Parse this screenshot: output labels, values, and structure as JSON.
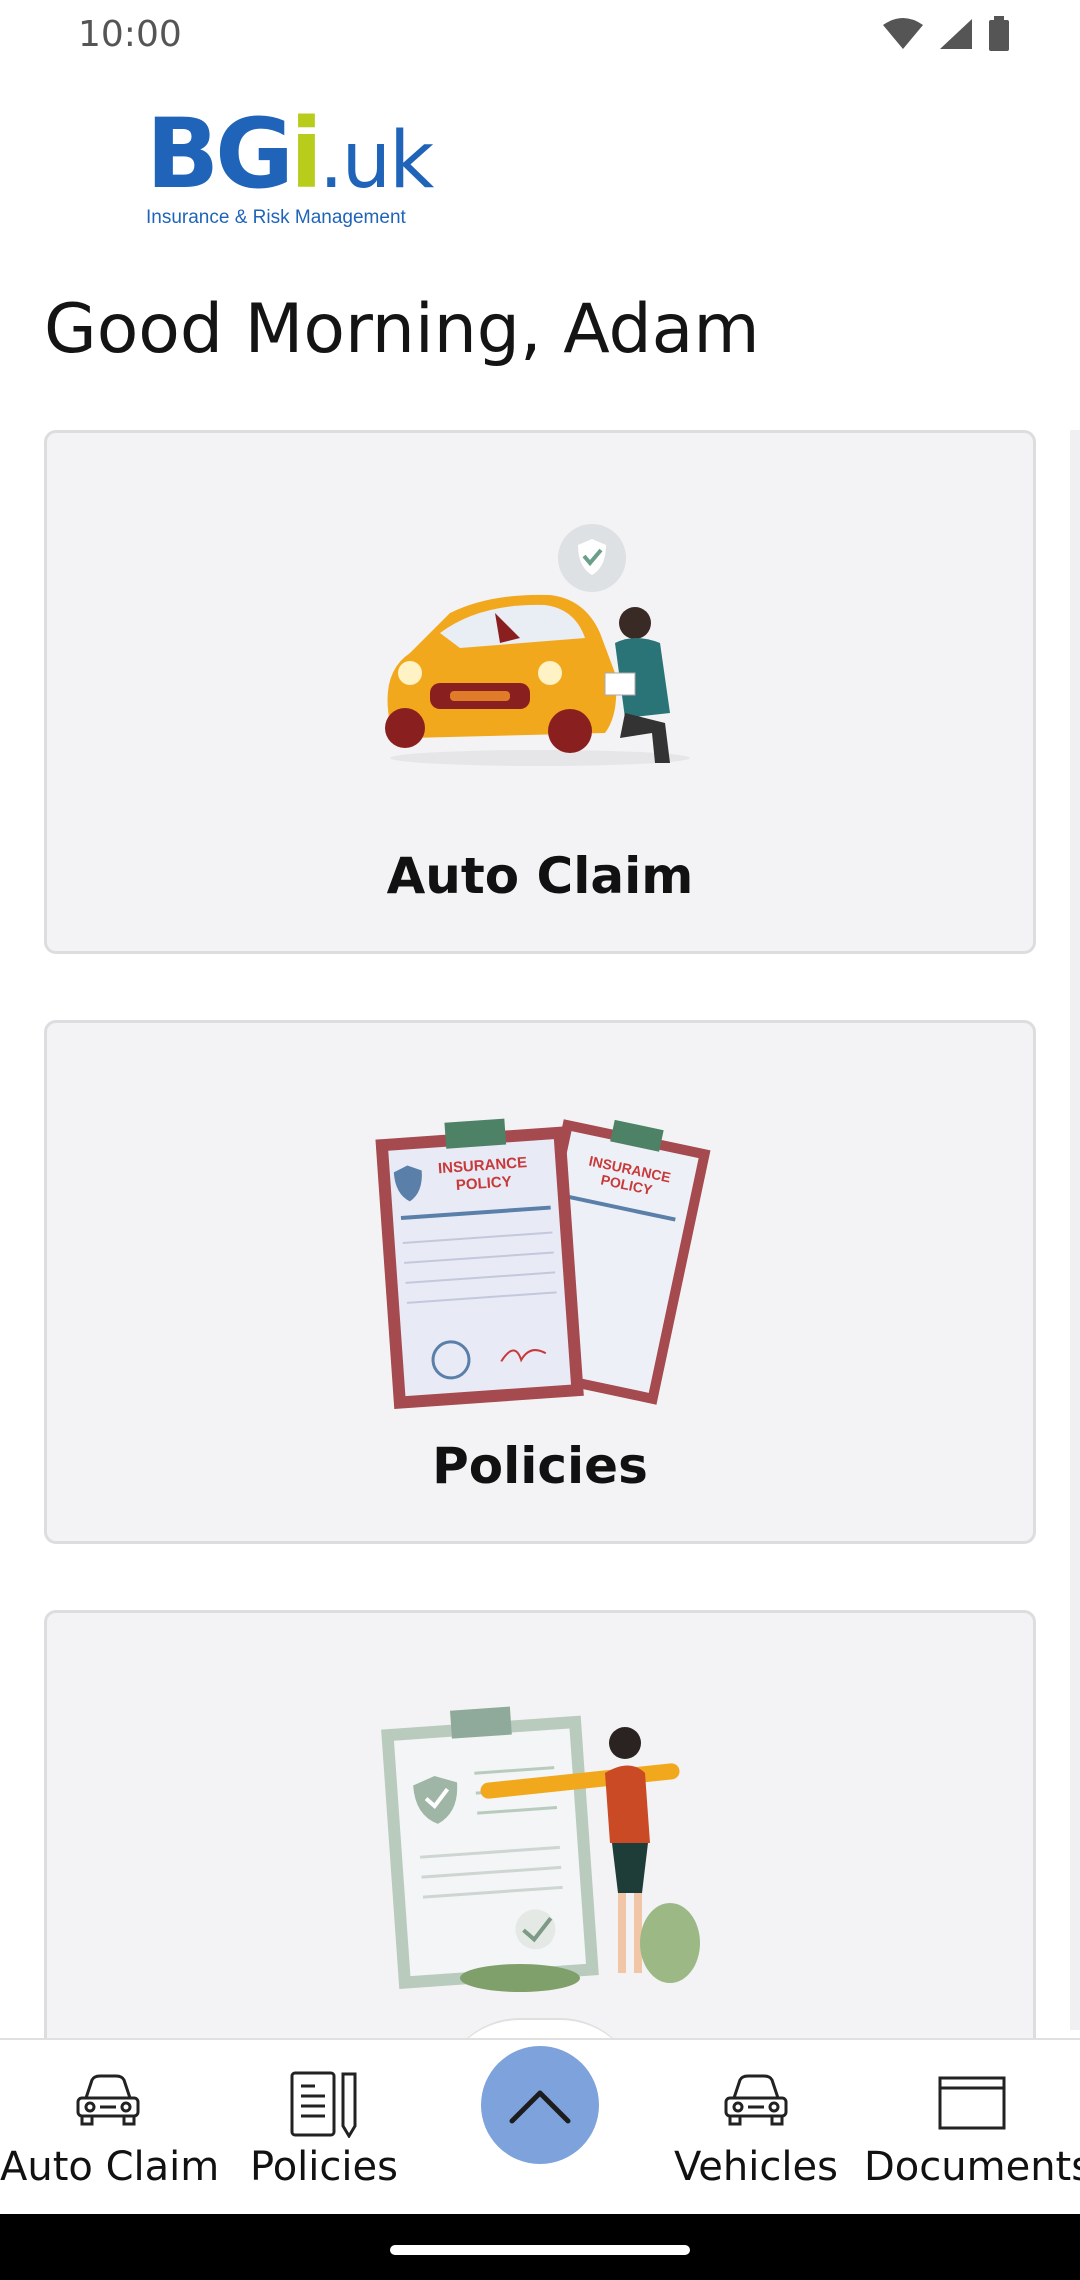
{
  "status_bar": {
    "time": "10:00",
    "icons": [
      "wifi-icon",
      "signal-icon",
      "battery-icon"
    ]
  },
  "logo": {
    "main_b": "BG",
    "main_i": "i",
    "main_uk": ".uk",
    "tagline": "Insurance & Risk Management",
    "colors": {
      "primary": "#1f64b8",
      "accent": "#b8cc1c"
    }
  },
  "greeting": "Good Morning, Adam",
  "cards": [
    {
      "label": "Auto Claim",
      "illustration": "car-claim-illustration"
    },
    {
      "label": "Policies",
      "illustration": "insurance-policy-illustration",
      "illustration_text": "INSURANCE POLICY"
    },
    {
      "label": "",
      "illustration": "checklist-illustration"
    }
  ],
  "bottom_nav": {
    "items": [
      {
        "label": "Auto Claim",
        "icon": "car-icon"
      },
      {
        "label": "Policies",
        "icon": "document-pencil-icon"
      },
      {
        "label": "Vehicles",
        "icon": "car-icon"
      },
      {
        "label": "Documents",
        "icon": "folder-icon"
      }
    ],
    "fab_icon": "chevron-up-icon",
    "fab_color": "#7da2dc"
  }
}
